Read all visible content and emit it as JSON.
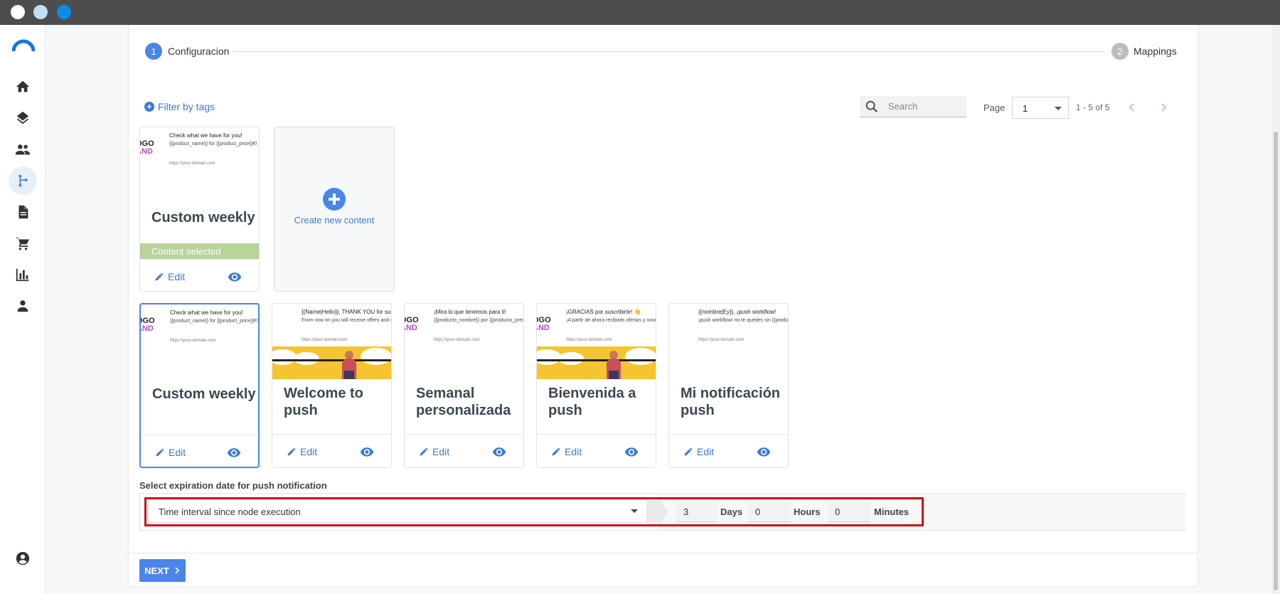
{
  "stepper": {
    "steps": [
      {
        "number": "1",
        "label": "Configuracion",
        "active": true
      },
      {
        "number": "2",
        "label": "Mappings",
        "active": false
      }
    ]
  },
  "toolbar": {
    "filter_label": "Filter by tags",
    "search_placeholder": "Search",
    "page_label": "Page",
    "page_value": "1",
    "range_text": "1 - 5 of 5"
  },
  "selected_content": {
    "title": "Custom weekly",
    "badge": "Content selected",
    "edit_label": "Edit"
  },
  "create_new": {
    "label": "Create new content"
  },
  "cards": [
    {
      "title": "Custom weekly",
      "edit_label": "Edit",
      "preview_title": "Check what we have for you!",
      "preview_body": "{{product_name}} for {{product_price}}€!",
      "preview_url": "https://your-domain.com",
      "logo_top": "OGO",
      "logo_bottom": "AND",
      "banner": false
    },
    {
      "title": "Welcome to push",
      "edit_label": "Edit",
      "preview_title": "{{Name|Hello}}, THANK YOU for subscribing! 👋",
      "preview_body": "From now on you will receive offers and news so that you don't miss any!",
      "preview_url": "https://your-domain.com",
      "logo_top": "",
      "logo_bottom": "",
      "banner": true
    },
    {
      "title": "Semanal personalizada",
      "edit_label": "Edit",
      "preview_title": "¡Mira lo que tenemos para ti!",
      "preview_body": "{{producto_nombre}} por {{producto_precio}}€!",
      "preview_url": "https://your-domain.com",
      "logo_top": "OGO",
      "logo_bottom": "AND",
      "banner": false
    },
    {
      "title": "Bienvenida a push",
      "edit_label": "Edit",
      "preview_title": "¡GRACIAS por suscribirte! 👋",
      "preview_body": "¡A partir de ahora recibirás ofertas y novedades para que no se te escape ninguna!",
      "preview_url": "https://your-domain.com",
      "logo_top": "OGO",
      "logo_bottom": "AND",
      "banner": true
    },
    {
      "title": "Mi notificación push",
      "edit_label": "Edit",
      "preview_title": "{{nombre|Ey}}, ¡push workflow!",
      "preview_body": "¡push workflow! no te quedes sin {{producto}}",
      "preview_url": "https://your-domain.com",
      "logo_top": "",
      "logo_bottom": "",
      "banner": false
    }
  ],
  "expiration": {
    "label": "Select expiration date for push notification",
    "mode": "Time interval since node execution",
    "days_value": "3",
    "days_label": "Days",
    "hours_value": "0",
    "hours_label": "Hours",
    "minutes_value": "0",
    "minutes_label": "Minutes"
  },
  "next_button": {
    "label": "NEXT"
  },
  "colors": {
    "accent": "#4a86e8",
    "link": "#3a7bd5",
    "selected_badge": "#b9d39a",
    "highlight": "#d0021b"
  },
  "sidebar": {
    "items": [
      {
        "icon": "home-icon"
      },
      {
        "icon": "layers-icon"
      },
      {
        "icon": "people-icon"
      },
      {
        "icon": "workflow-icon",
        "active": true
      },
      {
        "icon": "document-icon"
      },
      {
        "icon": "cart-icon"
      },
      {
        "icon": "chart-icon"
      },
      {
        "icon": "person-icon"
      }
    ],
    "bottom_icon": "account-icon"
  }
}
